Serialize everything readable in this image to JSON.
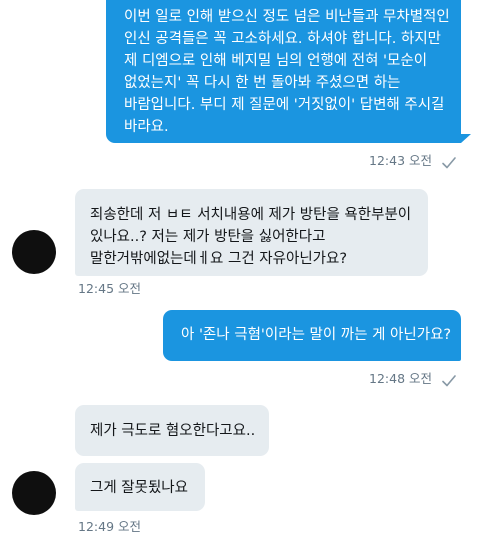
{
  "messages": [
    {
      "direction": "outgoing",
      "text": "이번 일로 인해 받으신 정도 넘은 비난들과 무차별적인\n인신 공격들은 꼭 고소하세요. 하셔야 합니다. 하지만\n제 디엠으로 인해 베지밀 님의 언행에 전혀 '모순이\n없었는지' 꼭 다시 한 번 돌아봐 주셨으면 하는\n바람입니다. 부디 제 질문에 '거짓없이' 답변해 주시길\n바라요.",
      "time": "12:43 오전",
      "status_icon": "read-check-icon"
    },
    {
      "direction": "incoming",
      "text": "죄송한데 저 ㅂㅌ 서치내용에 제가 방탄을 욕한부분이\n있나요..? 저는 제가 방탄을 싫어한다고\n말한거밖에없는데ㅔ요 그건 자유아닌가요?",
      "time": "12:45 오전"
    },
    {
      "direction": "outgoing",
      "text": "아 '존나 극혐'이라는 말이 까는 게 아닌가요?",
      "time": "12:48 오전",
      "status_icon": "read-check-icon"
    },
    {
      "direction": "incoming",
      "text": "제가 극도로 혐오한다고요..",
      "time": ""
    },
    {
      "direction": "incoming",
      "text": "그게 잘못됬나요",
      "time": "12:49 오전"
    }
  ],
  "colors": {
    "outgoing_bubble": "#1b95e0",
    "incoming_bubble": "#e6ecf0",
    "meta_text": "#657786",
    "avatar": "#0f0f0f"
  }
}
